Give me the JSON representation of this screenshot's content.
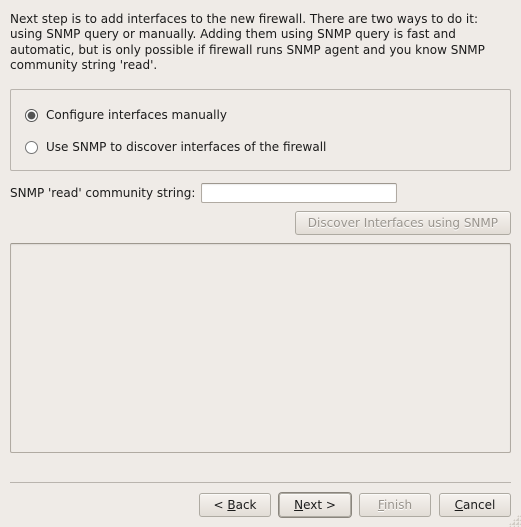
{
  "intro": "Next step is to add interfaces to the new firewall. There are two ways to do it: using SNMP query or manually. Adding them using SNMP query is fast and automatic, but is only possible if firewall runs SNMP agent and you know SNMP community string 'read'.",
  "options": {
    "manual": "Configure interfaces manually",
    "snmp": "Use SNMP to discover interfaces of the firewall",
    "selected": "manual"
  },
  "snmp": {
    "label": "SNMP 'read' community string:",
    "value": "",
    "discover_label": "Discover Interfaces using SNMP"
  },
  "buttons": {
    "back_prefix": "< ",
    "back_mnemonic": "B",
    "back_suffix": "ack",
    "next_mnemonic": "N",
    "next_suffix": "ext >",
    "finish_mnemonic": "F",
    "finish_suffix": "inish",
    "cancel_mnemonic": "C",
    "cancel_suffix": "ancel"
  }
}
